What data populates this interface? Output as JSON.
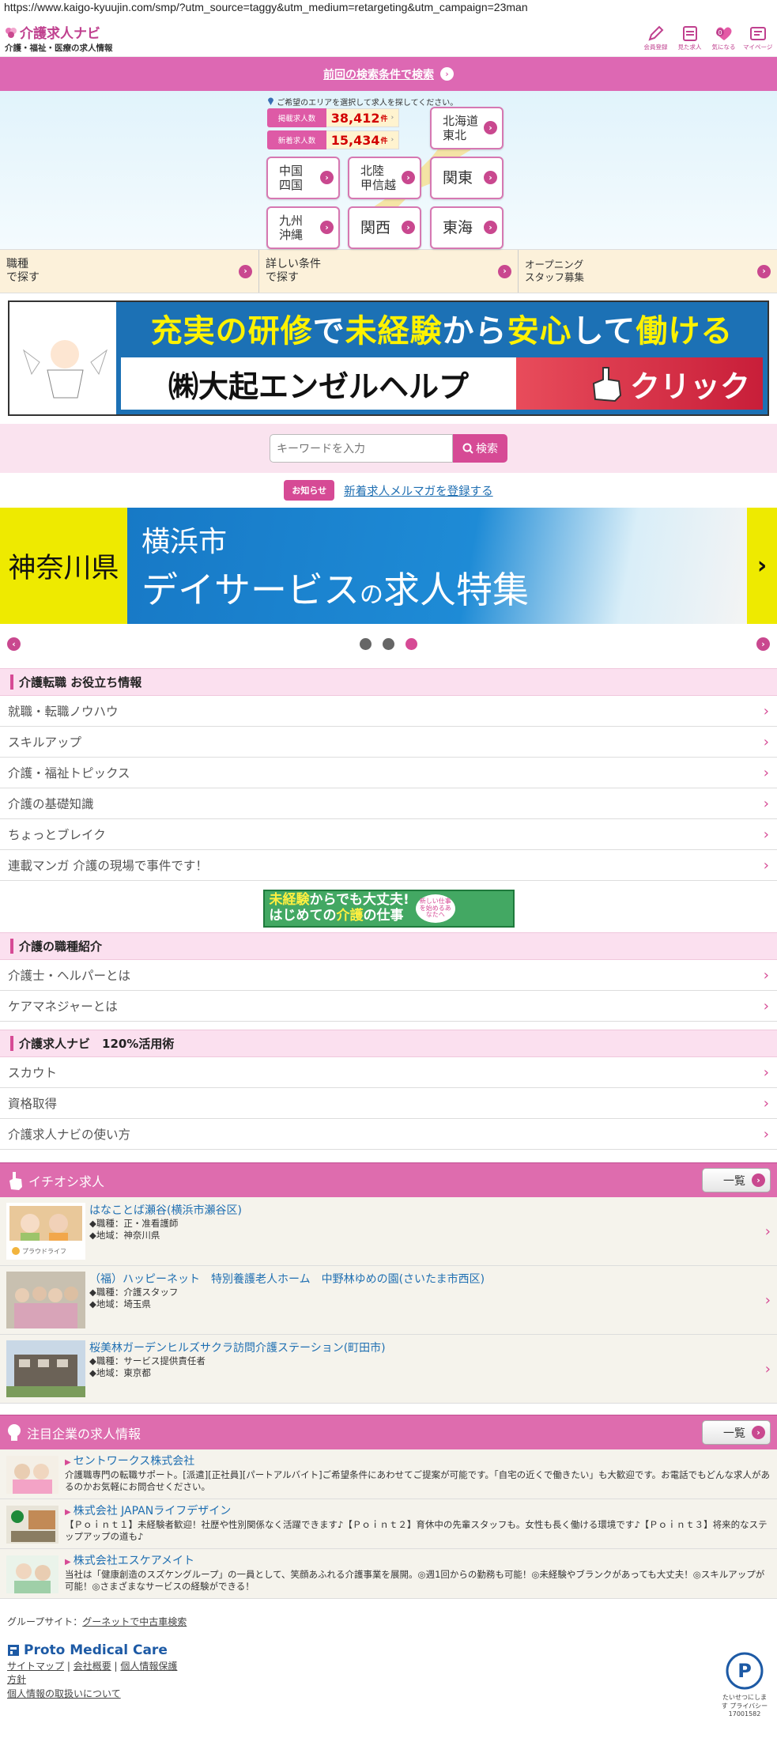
{
  "browser": {
    "url": "https://www.kaigo-kyuujin.com/smp/?utm_source=taggy&utm_medium=retargeting&utm_campaign=23man"
  },
  "header": {
    "logo": "介護求人ナビ",
    "logo_sub": "介護・福祉・医療の求人情報",
    "icons": [
      {
        "label": "会員登録",
        "icon": "pencil-icon"
      },
      {
        "label": "見た求人",
        "icon": "calendar-icon"
      },
      {
        "label": "気になる",
        "icon": "heart-icon"
      },
      {
        "label": "マイページ",
        "icon": "page-icon"
      }
    ]
  },
  "prev_search": {
    "label": "前回の検索条件で検索"
  },
  "area": {
    "instruction": "ご希望のエリアを選択して求人を探してください。",
    "stats": [
      {
        "label": "掲載求人数",
        "value": "38,412",
        "unit": "件"
      },
      {
        "label": "新着求人数",
        "value": "15,434",
        "unit": "件"
      }
    ],
    "regions": [
      {
        "line1": "北海道",
        "line2": "東北"
      },
      {
        "line1": "中国",
        "line2": "四国"
      },
      {
        "line1": "北陸",
        "line2": "甲信越"
      },
      {
        "line1": "関東",
        "line2": ""
      },
      {
        "line1": "九州",
        "line2": "沖縄"
      },
      {
        "line1": "関西",
        "line2": ""
      },
      {
        "line1": "東海",
        "line2": ""
      }
    ]
  },
  "search_options": [
    {
      "line1": "職種",
      "line2": "で探す"
    },
    {
      "line1": "詳しい条件",
      "line2": "で探す"
    },
    {
      "line1": "オープニング",
      "line2": "スタッフ募集"
    }
  ],
  "banner1": {
    "seg1": "充実の研修",
    "seg2": "で",
    "seg3": "未経験",
    "seg4": "から",
    "seg5": "安心",
    "seg6": "して",
    "seg7": "働ける",
    "company": "㈱大起エンゼルヘルプ",
    "click": "クリック"
  },
  "keyword": {
    "placeholder": "キーワードを入力",
    "button": "検索"
  },
  "notice": {
    "badge": "お知らせ",
    "link": "新着求人メルマガを登録する"
  },
  "banner2": {
    "pref": "神奈川県",
    "city": "横浜市",
    "main_a": "デイサービス",
    "main_b": "の",
    "main_c": "求人特集"
  },
  "info": {
    "title": "介護転職 お役立ち情報",
    "items": [
      "就職・転職ノウハウ",
      "スキルアップ",
      "介護・福祉トピックス",
      "介護の基礎知識",
      "ちょっとブレイク",
      "連載マンガ 介護の現場で事件です！"
    ]
  },
  "mini_banner": {
    "a": "未経験",
    "b": "からでも大丈夫!",
    "c": "はじめての",
    "d": "介護",
    "e": "の仕事",
    "tag": "新しい仕事を始めるあなたへ"
  },
  "occupations": {
    "title": "介護の職種紹介",
    "items": [
      "介護士・ヘルパーとは",
      "ケアマネジャーとは"
    ]
  },
  "usage": {
    "title": "介護求人ナビ　120%活用術",
    "items": [
      "スカウト",
      "資格取得",
      "介護求人ナビの使い方"
    ]
  },
  "pickup": {
    "title": "イチオシ求人",
    "all": "一覧",
    "jobs": [
      {
        "title": "はなことば瀬谷(横浜市瀬谷区)",
        "role": "◆職種：正・准看護師",
        "area": "◆地域：神奈川県",
        "logo": "プラウドライフ"
      },
      {
        "title": "（福）ハッピーネット　特別養護老人ホーム　中野林ゆめの園(さいたま市西区)",
        "role": "◆職種：介護スタッフ",
        "area": "◆地域：埼玉県"
      },
      {
        "title": "桜美林ガーデンヒルズサクラ訪問介護ステーション(町田市)",
        "role": "◆職種：サービス提供責任者",
        "area": "◆地域：東京都"
      }
    ]
  },
  "featured": {
    "title": "注目企業の求人情報",
    "all": "一覧",
    "companies": [
      {
        "name": "セントワークス株式会社",
        "desc": "介護職専門の転職サポート。[派遣][正社員][パートアルバイト]ご希望条件にあわせてご提案が可能です。「自宅の近くで働きたい」も大歓迎です。お電話でもどんな求人があるのかお気軽にお問合せください。"
      },
      {
        "name": "株式会社 JAPANライフデザイン",
        "desc": "【Ｐｏｉｎｔ１】未経験者歓迎！社歴や性別関係なく活躍できます♪【Ｐｏｉｎｔ２】育休中の先輩スタッフも。女性も長く働ける環境です♪【Ｐｏｉｎｔ３】将来的なステップアップの道も♪"
      },
      {
        "name": "株式会社エスケアメイト",
        "desc": "当社は「健康創造のスズケングループ」の一員として、笑顔あふれる介護事業を展開。◎週1回からの勤務も可能！◎未経験やブランクがあっても大丈夫！◎スキルアップが可能！◎さまざまなサービスの経験ができる！"
      }
    ]
  },
  "footer": {
    "group_label": "グループサイト：",
    "group_link": "グーネットで中古車検索",
    "logo": "Proto Medical Care",
    "links": [
      "サイトマップ",
      "会社概要",
      "個人情報保護"
    ],
    "link4": "方針",
    "link5": "個人情報の取扱いについて",
    "pmark_text": "たいせつにします プライバシー",
    "pmark_no": "17001582"
  },
  "colors": {
    "accent": "#d64a95",
    "header_pink": "#dd68b3"
  }
}
